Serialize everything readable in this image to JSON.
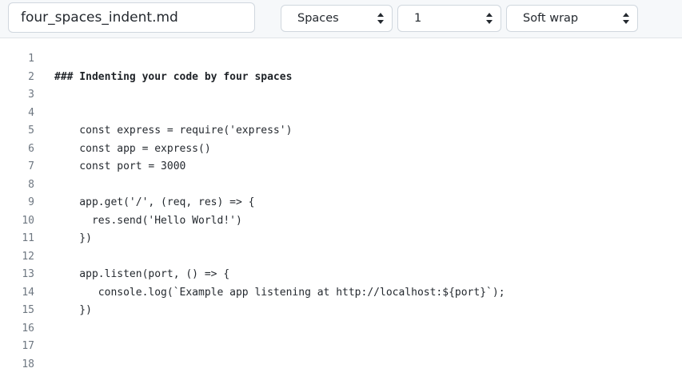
{
  "file": {
    "name": "four_spaces_indent.md"
  },
  "toolbar": {
    "indent_mode": "Spaces",
    "indent_size": "1",
    "wrap_mode": "Soft wrap"
  },
  "icons": {
    "select_arrows": "up-down-chevron-icon"
  },
  "editor": {
    "lines": [
      {
        "num": "1",
        "text": "",
        "style": "normal"
      },
      {
        "num": "2",
        "text": "### Indenting your code by four spaces",
        "style": "heading"
      },
      {
        "num": "3",
        "text": "",
        "style": "normal"
      },
      {
        "num": "4",
        "text": "",
        "style": "normal"
      },
      {
        "num": "5",
        "text": "    const express = require('express')",
        "style": "normal"
      },
      {
        "num": "6",
        "text": "    const app = express()",
        "style": "normal"
      },
      {
        "num": "7",
        "text": "    const port = 3000",
        "style": "normal"
      },
      {
        "num": "8",
        "text": "",
        "style": "normal"
      },
      {
        "num": "9",
        "text": "    app.get('/', (req, res) => {",
        "style": "normal"
      },
      {
        "num": "10",
        "text": "      res.send('Hello World!')",
        "style": "normal"
      },
      {
        "num": "11",
        "text": "    })",
        "style": "normal"
      },
      {
        "num": "12",
        "text": "",
        "style": "normal"
      },
      {
        "num": "13",
        "text": "    app.listen(port, () => {",
        "style": "normal"
      },
      {
        "num": "14",
        "text": "       console.log(`Example app listening at http://localhost:${port}`);",
        "style": "normal"
      },
      {
        "num": "15",
        "text": "    })",
        "style": "normal"
      },
      {
        "num": "16",
        "text": "",
        "style": "normal"
      },
      {
        "num": "17",
        "text": "",
        "style": "normal"
      },
      {
        "num": "18",
        "text": "",
        "style": "normal"
      }
    ]
  }
}
